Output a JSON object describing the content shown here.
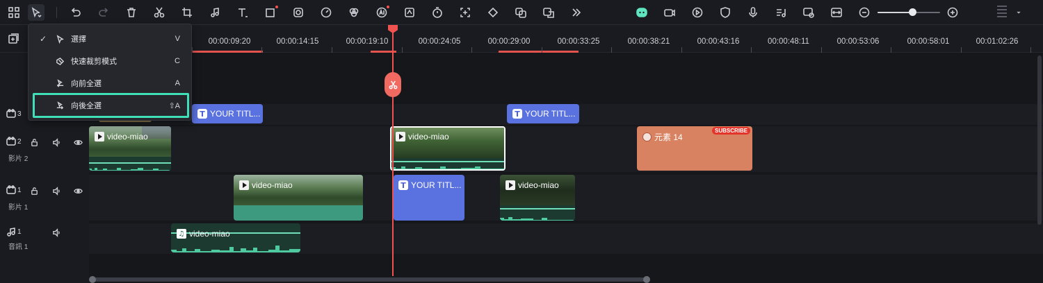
{
  "toolbar": {
    "icons": [
      "grid-icon",
      "select-tool-icon",
      "undo-icon",
      "redo-icon",
      "delete-icon",
      "cut-icon",
      "crop-icon",
      "audio-edit-icon",
      "text-icon",
      "shape-icon",
      "mask-icon",
      "speed-icon",
      "color-icon",
      "ai-icon",
      "stabilize-icon",
      "timer-icon",
      "zoom-fit-icon",
      "keyframe-icon",
      "translate-icon",
      "subtitle-icon",
      "more-icon",
      "ai-assistant-icon",
      "record-icon",
      "render-preview-icon",
      "shield-icon",
      "mic-icon",
      "music-list-icon",
      "auto-icon",
      "fit-width-icon",
      "zoom-out-icon",
      "zoom-in-icon",
      "layout-grip-icon"
    ],
    "accent_dot_color": "#f0524f",
    "zoom_level": 0.55
  },
  "menu": {
    "items": [
      {
        "label": "選擇",
        "shortcut": "V",
        "checked": "✓",
        "icon": "cursor-icon"
      },
      {
        "label": "快速裁剪模式",
        "shortcut": "C",
        "checked": "",
        "icon": "trim-icon"
      },
      {
        "label": "向前全選",
        "shortcut": "A",
        "checked": "",
        "icon": "select-forward-icon"
      },
      {
        "label": "向後全選",
        "shortcut": "⇧A",
        "checked": "",
        "icon": "select-backward-icon"
      }
    ],
    "highlight_color": "#3fdfb8"
  },
  "ruler": {
    "ticks": [
      "00:00:09:20",
      "00:00:14:15",
      "00:00:19:10",
      "00:00:24:05",
      "00:00:29:00",
      "00:00:33:25",
      "00:00:38:21",
      "00:00:43:16",
      "00:00:48:11",
      "00:00:53:06",
      "00:00:58:01",
      "00:01:02:26"
    ]
  },
  "tracks": [
    {
      "icon": "video-track-icon",
      "num": "3",
      "name": ""
    },
    {
      "icon": "video-track-icon",
      "num": "2",
      "name": "影片 2"
    },
    {
      "icon": "video-track-icon",
      "num": "1",
      "name": "影片 1"
    },
    {
      "icon": "music-track-icon",
      "num": "1",
      "name": "音訊 1"
    }
  ],
  "clips": {
    "title_a": "YOUR TITL...",
    "title_b": "YOUR TITL...",
    "title_c": "YOUR TITL...",
    "v2_a": "video-miao",
    "v2_b": "video-miao",
    "element": "元素 14",
    "element_tag": "SUBSCRIBE",
    "v1_a": "video-miao",
    "v1_b": "video-miao",
    "audio": "video-miao"
  },
  "colors": {
    "title_clip": "#5a72e0",
    "element_clip": "#d98262",
    "video_clip_bg": "#1d3a31",
    "audio_wave": "#4fc9a0",
    "playhead": "#f0524f"
  }
}
